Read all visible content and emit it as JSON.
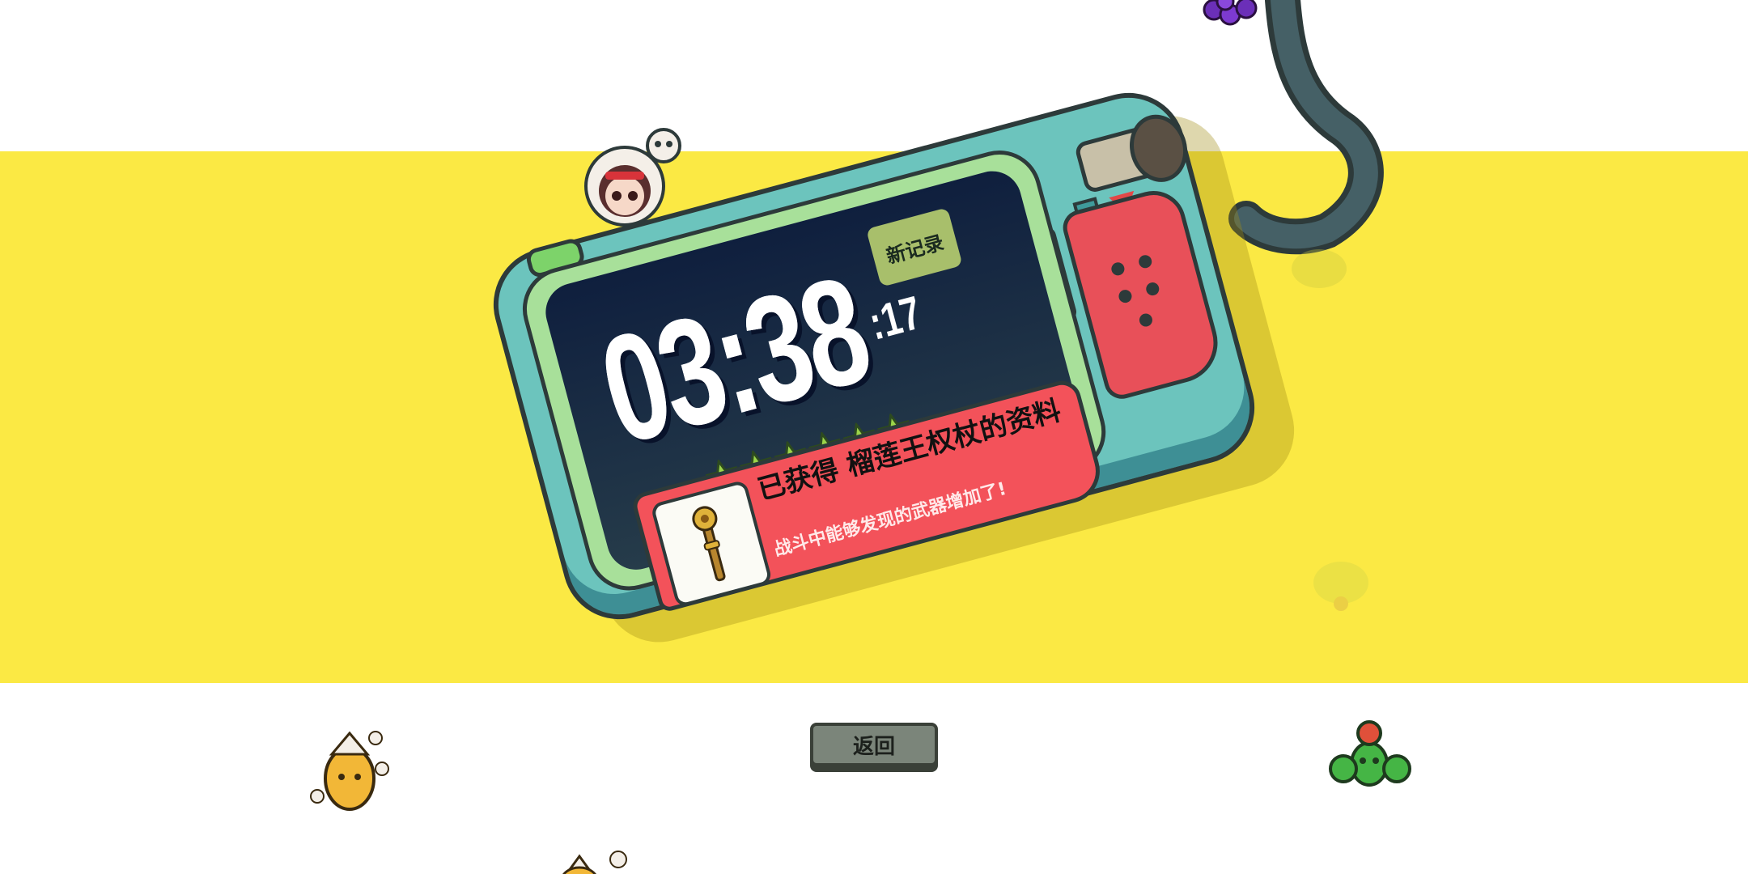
{
  "result": {
    "time_main": "03:38",
    "time_ms": ":17",
    "record_badge": "新记录",
    "stars_count": 6
  },
  "reward": {
    "title": "已获得 榴莲王权杖的资料",
    "subtitle": "战斗中能够发现的武器增加了!",
    "item_icon": "durian-king-scepter-icon"
  },
  "buttons": {
    "back_label": "返回"
  },
  "colors": {
    "band": "#fbe944",
    "device_body": "#6cc4bd",
    "screen": "#0f1f3e",
    "reward_strip": "#f3525a",
    "back_button": "#7b857a",
    "star": "#9bd44a"
  }
}
